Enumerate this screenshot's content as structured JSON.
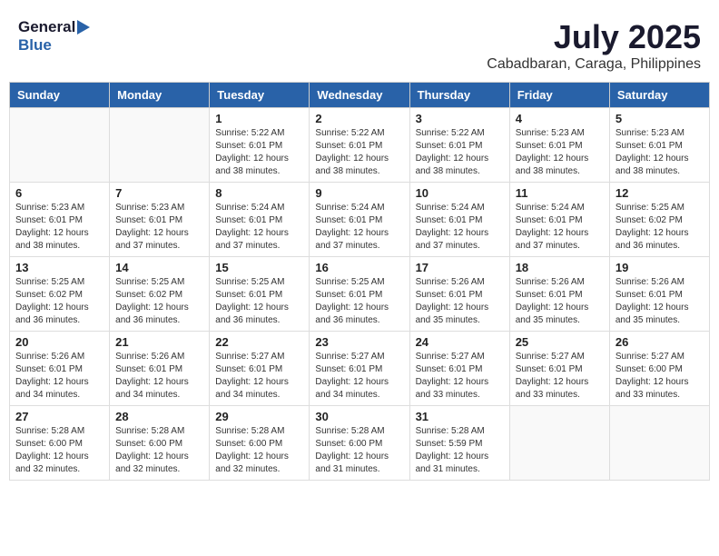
{
  "header": {
    "logo_general": "General",
    "logo_blue": "Blue",
    "month": "July 2025",
    "location": "Cabadbaran, Caraga, Philippines"
  },
  "weekdays": [
    "Sunday",
    "Monday",
    "Tuesday",
    "Wednesday",
    "Thursday",
    "Friday",
    "Saturday"
  ],
  "weeks": [
    [
      {
        "day": "",
        "content": ""
      },
      {
        "day": "",
        "content": ""
      },
      {
        "day": "1",
        "content": "Sunrise: 5:22 AM\nSunset: 6:01 PM\nDaylight: 12 hours\nand 38 minutes."
      },
      {
        "day": "2",
        "content": "Sunrise: 5:22 AM\nSunset: 6:01 PM\nDaylight: 12 hours\nand 38 minutes."
      },
      {
        "day": "3",
        "content": "Sunrise: 5:22 AM\nSunset: 6:01 PM\nDaylight: 12 hours\nand 38 minutes."
      },
      {
        "day": "4",
        "content": "Sunrise: 5:23 AM\nSunset: 6:01 PM\nDaylight: 12 hours\nand 38 minutes."
      },
      {
        "day": "5",
        "content": "Sunrise: 5:23 AM\nSunset: 6:01 PM\nDaylight: 12 hours\nand 38 minutes."
      }
    ],
    [
      {
        "day": "6",
        "content": "Sunrise: 5:23 AM\nSunset: 6:01 PM\nDaylight: 12 hours\nand 38 minutes."
      },
      {
        "day": "7",
        "content": "Sunrise: 5:23 AM\nSunset: 6:01 PM\nDaylight: 12 hours\nand 37 minutes."
      },
      {
        "day": "8",
        "content": "Sunrise: 5:24 AM\nSunset: 6:01 PM\nDaylight: 12 hours\nand 37 minutes."
      },
      {
        "day": "9",
        "content": "Sunrise: 5:24 AM\nSunset: 6:01 PM\nDaylight: 12 hours\nand 37 minutes."
      },
      {
        "day": "10",
        "content": "Sunrise: 5:24 AM\nSunset: 6:01 PM\nDaylight: 12 hours\nand 37 minutes."
      },
      {
        "day": "11",
        "content": "Sunrise: 5:24 AM\nSunset: 6:01 PM\nDaylight: 12 hours\nand 37 minutes."
      },
      {
        "day": "12",
        "content": "Sunrise: 5:25 AM\nSunset: 6:02 PM\nDaylight: 12 hours\nand 36 minutes."
      }
    ],
    [
      {
        "day": "13",
        "content": "Sunrise: 5:25 AM\nSunset: 6:02 PM\nDaylight: 12 hours\nand 36 minutes."
      },
      {
        "day": "14",
        "content": "Sunrise: 5:25 AM\nSunset: 6:02 PM\nDaylight: 12 hours\nand 36 minutes."
      },
      {
        "day": "15",
        "content": "Sunrise: 5:25 AM\nSunset: 6:01 PM\nDaylight: 12 hours\nand 36 minutes."
      },
      {
        "day": "16",
        "content": "Sunrise: 5:25 AM\nSunset: 6:01 PM\nDaylight: 12 hours\nand 36 minutes."
      },
      {
        "day": "17",
        "content": "Sunrise: 5:26 AM\nSunset: 6:01 PM\nDaylight: 12 hours\nand 35 minutes."
      },
      {
        "day": "18",
        "content": "Sunrise: 5:26 AM\nSunset: 6:01 PM\nDaylight: 12 hours\nand 35 minutes."
      },
      {
        "day": "19",
        "content": "Sunrise: 5:26 AM\nSunset: 6:01 PM\nDaylight: 12 hours\nand 35 minutes."
      }
    ],
    [
      {
        "day": "20",
        "content": "Sunrise: 5:26 AM\nSunset: 6:01 PM\nDaylight: 12 hours\nand 34 minutes."
      },
      {
        "day": "21",
        "content": "Sunrise: 5:26 AM\nSunset: 6:01 PM\nDaylight: 12 hours\nand 34 minutes."
      },
      {
        "day": "22",
        "content": "Sunrise: 5:27 AM\nSunset: 6:01 PM\nDaylight: 12 hours\nand 34 minutes."
      },
      {
        "day": "23",
        "content": "Sunrise: 5:27 AM\nSunset: 6:01 PM\nDaylight: 12 hours\nand 34 minutes."
      },
      {
        "day": "24",
        "content": "Sunrise: 5:27 AM\nSunset: 6:01 PM\nDaylight: 12 hours\nand 33 minutes."
      },
      {
        "day": "25",
        "content": "Sunrise: 5:27 AM\nSunset: 6:01 PM\nDaylight: 12 hours\nand 33 minutes."
      },
      {
        "day": "26",
        "content": "Sunrise: 5:27 AM\nSunset: 6:00 PM\nDaylight: 12 hours\nand 33 minutes."
      }
    ],
    [
      {
        "day": "27",
        "content": "Sunrise: 5:28 AM\nSunset: 6:00 PM\nDaylight: 12 hours\nand 32 minutes."
      },
      {
        "day": "28",
        "content": "Sunrise: 5:28 AM\nSunset: 6:00 PM\nDaylight: 12 hours\nand 32 minutes."
      },
      {
        "day": "29",
        "content": "Sunrise: 5:28 AM\nSunset: 6:00 PM\nDaylight: 12 hours\nand 32 minutes."
      },
      {
        "day": "30",
        "content": "Sunrise: 5:28 AM\nSunset: 6:00 PM\nDaylight: 12 hours\nand 31 minutes."
      },
      {
        "day": "31",
        "content": "Sunrise: 5:28 AM\nSunset: 5:59 PM\nDaylight: 12 hours\nand 31 minutes."
      },
      {
        "day": "",
        "content": ""
      },
      {
        "day": "",
        "content": ""
      }
    ]
  ]
}
